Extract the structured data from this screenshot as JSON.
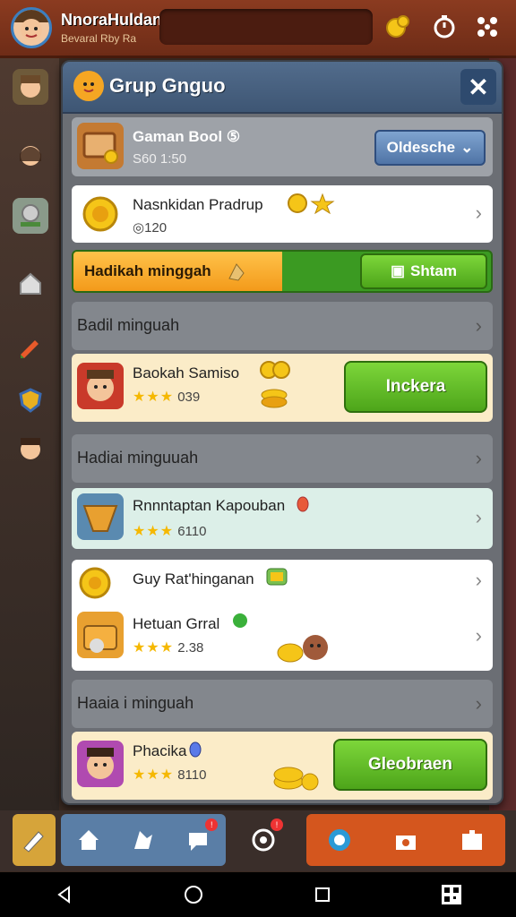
{
  "topbar": {
    "player_name": "NnoraHuldan",
    "player_sub": "Bevaral Rby Ra"
  },
  "panel": {
    "title": "Grup Gnguo",
    "close_label": "✕"
  },
  "row1": {
    "title": "Gaman Bool ⑤",
    "value": "S60 1:50",
    "dropdown_label": "Oldesche"
  },
  "row2": {
    "title": "Nasnkidan Pradrup",
    "value": "◎120"
  },
  "progress": {
    "label": "Hadikah minggah",
    "button_label": "Shtam",
    "fill": 0.5
  },
  "section1": {
    "label": "Badil minguah"
  },
  "row3": {
    "title": "Baokah Samiso",
    "rating": "★★★",
    "value": "039",
    "button_label": "Inckera"
  },
  "section2": {
    "label": "Hadiai minguuah"
  },
  "row4": {
    "title": "Rnnntaptan Kapouban",
    "rating": "★★★",
    "value": "6110"
  },
  "row5": {
    "title_a": "Guy Rat'hinganan",
    "title_b": "Hetuan Grral",
    "rating": "★★★",
    "value": "2.38"
  },
  "section3": {
    "label": "Haaia i minguah"
  },
  "row6": {
    "title": "Phacika",
    "rating": "★★★",
    "value": "8110",
    "button_label": "Gleobraen"
  },
  "icons": {
    "home": "home-icon",
    "map": "map-icon",
    "chat": "chat-icon",
    "radar": "radar-icon",
    "help": "help-icon",
    "shop": "shop-icon",
    "puzzle": "puzzle-icon"
  },
  "colors": {
    "accent_green": "#5ab824",
    "accent_orange": "#f5a623",
    "header_blue": "#4a6488",
    "topbar": "#7d331a"
  }
}
